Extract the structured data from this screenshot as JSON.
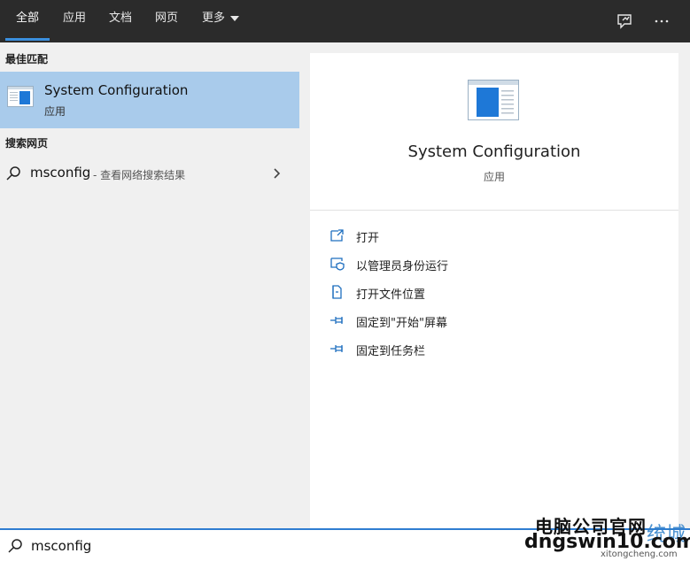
{
  "tabs": [
    {
      "label": "全部",
      "active": true
    },
    {
      "label": "应用"
    },
    {
      "label": "文档"
    },
    {
      "label": "网页"
    },
    {
      "label": "更多"
    }
  ],
  "top_icons": [
    "feedback-icon",
    "more-options-icon"
  ],
  "left": {
    "best_match_header": "最佳匹配",
    "best_match": {
      "title": "System Configuration",
      "subtitle": "应用",
      "icon": "msconfig-app-icon"
    },
    "web_header": "搜索网页",
    "web_result": {
      "term": "msconfig",
      "hint": "- 查看网络搜索结果"
    }
  },
  "detail": {
    "title": "System Configuration",
    "subtitle": "应用",
    "actions": [
      {
        "label": "打开",
        "icon": "open-icon"
      },
      {
        "label": "以管理员身份运行",
        "icon": "run-as-admin-icon"
      },
      {
        "label": "打开文件位置",
        "icon": "file-location-icon"
      },
      {
        "label": "固定到\"开始\"屏幕",
        "icon": "pin-icon"
      },
      {
        "label": "固定到任务栏",
        "icon": "pin-icon"
      }
    ]
  },
  "search": {
    "value": "msconfig"
  },
  "watermark": {
    "line1": "电脑公司官网",
    "line2": "dngswin10.com",
    "line3": "xitongcheng.com",
    "chars": "统城"
  },
  "colors": {
    "accent": "#2f7dd1",
    "selected_bg": "#a9cbeb",
    "topbar_bg": "#2b2b2b",
    "action_icon": "#1f6fbf"
  }
}
